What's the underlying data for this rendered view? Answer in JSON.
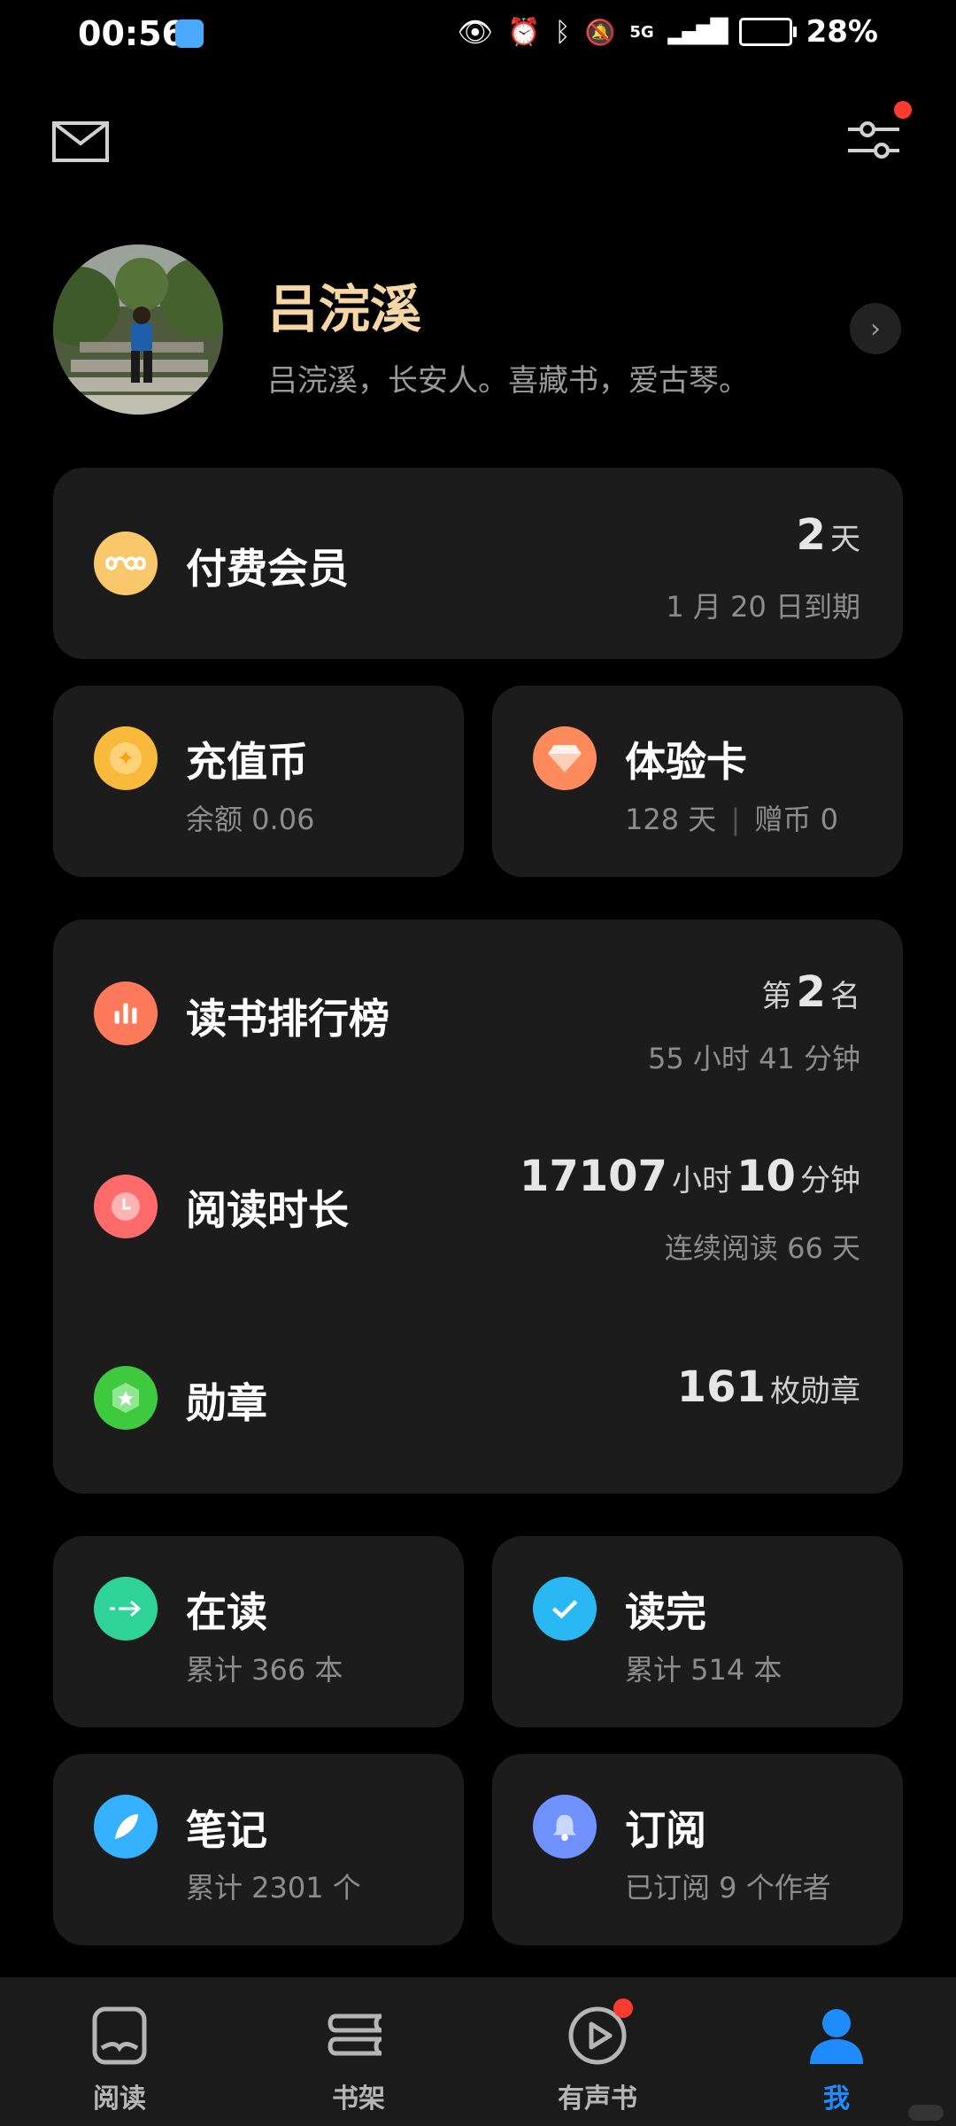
{
  "status_bar": {
    "time": "00:56",
    "network": "5G",
    "battery": "28%"
  },
  "profile": {
    "name": "吕浣溪",
    "bio": "吕浣溪，长安人。喜藏书，爱古琴。"
  },
  "membership": {
    "title": "付费会员",
    "days_value": "2",
    "days_unit": "天",
    "expiry": "1 月 20 日到期"
  },
  "coins": {
    "title": "充值币",
    "balance": "余额 0.06"
  },
  "trial_card": {
    "title": "体验卡",
    "days": "128 天",
    "gift": "赠币 0"
  },
  "ranking": {
    "title": "读书排行榜",
    "prefix": "第",
    "rank": "2",
    "suffix": "名",
    "time": "55 小时 41 分钟"
  },
  "reading_time": {
    "title": "阅读时长",
    "hours": "17107",
    "hours_unit": "小时",
    "minutes": "10",
    "minutes_unit": "分钟",
    "streak": "连续阅读 66 天"
  },
  "badges": {
    "title": "勋章",
    "count": "161",
    "unit": "枚勋章"
  },
  "reading_now": {
    "title": "在读",
    "count": "累计 366 本"
  },
  "finished": {
    "title": "读完",
    "count": "累计 514 本"
  },
  "notes": {
    "title": "笔记",
    "count": "累计 2301 个"
  },
  "subscriptions": {
    "title": "订阅",
    "count": "已订阅 9 个作者"
  },
  "nav": {
    "read": "阅读",
    "shelf": "书架",
    "audio": "有声书",
    "me": "我"
  },
  "colors": {
    "accent": "#1e8bff",
    "card_bg": "#1c1c1c",
    "name_gold": "#f7d6a6",
    "badge_red": "#ff3b30"
  }
}
